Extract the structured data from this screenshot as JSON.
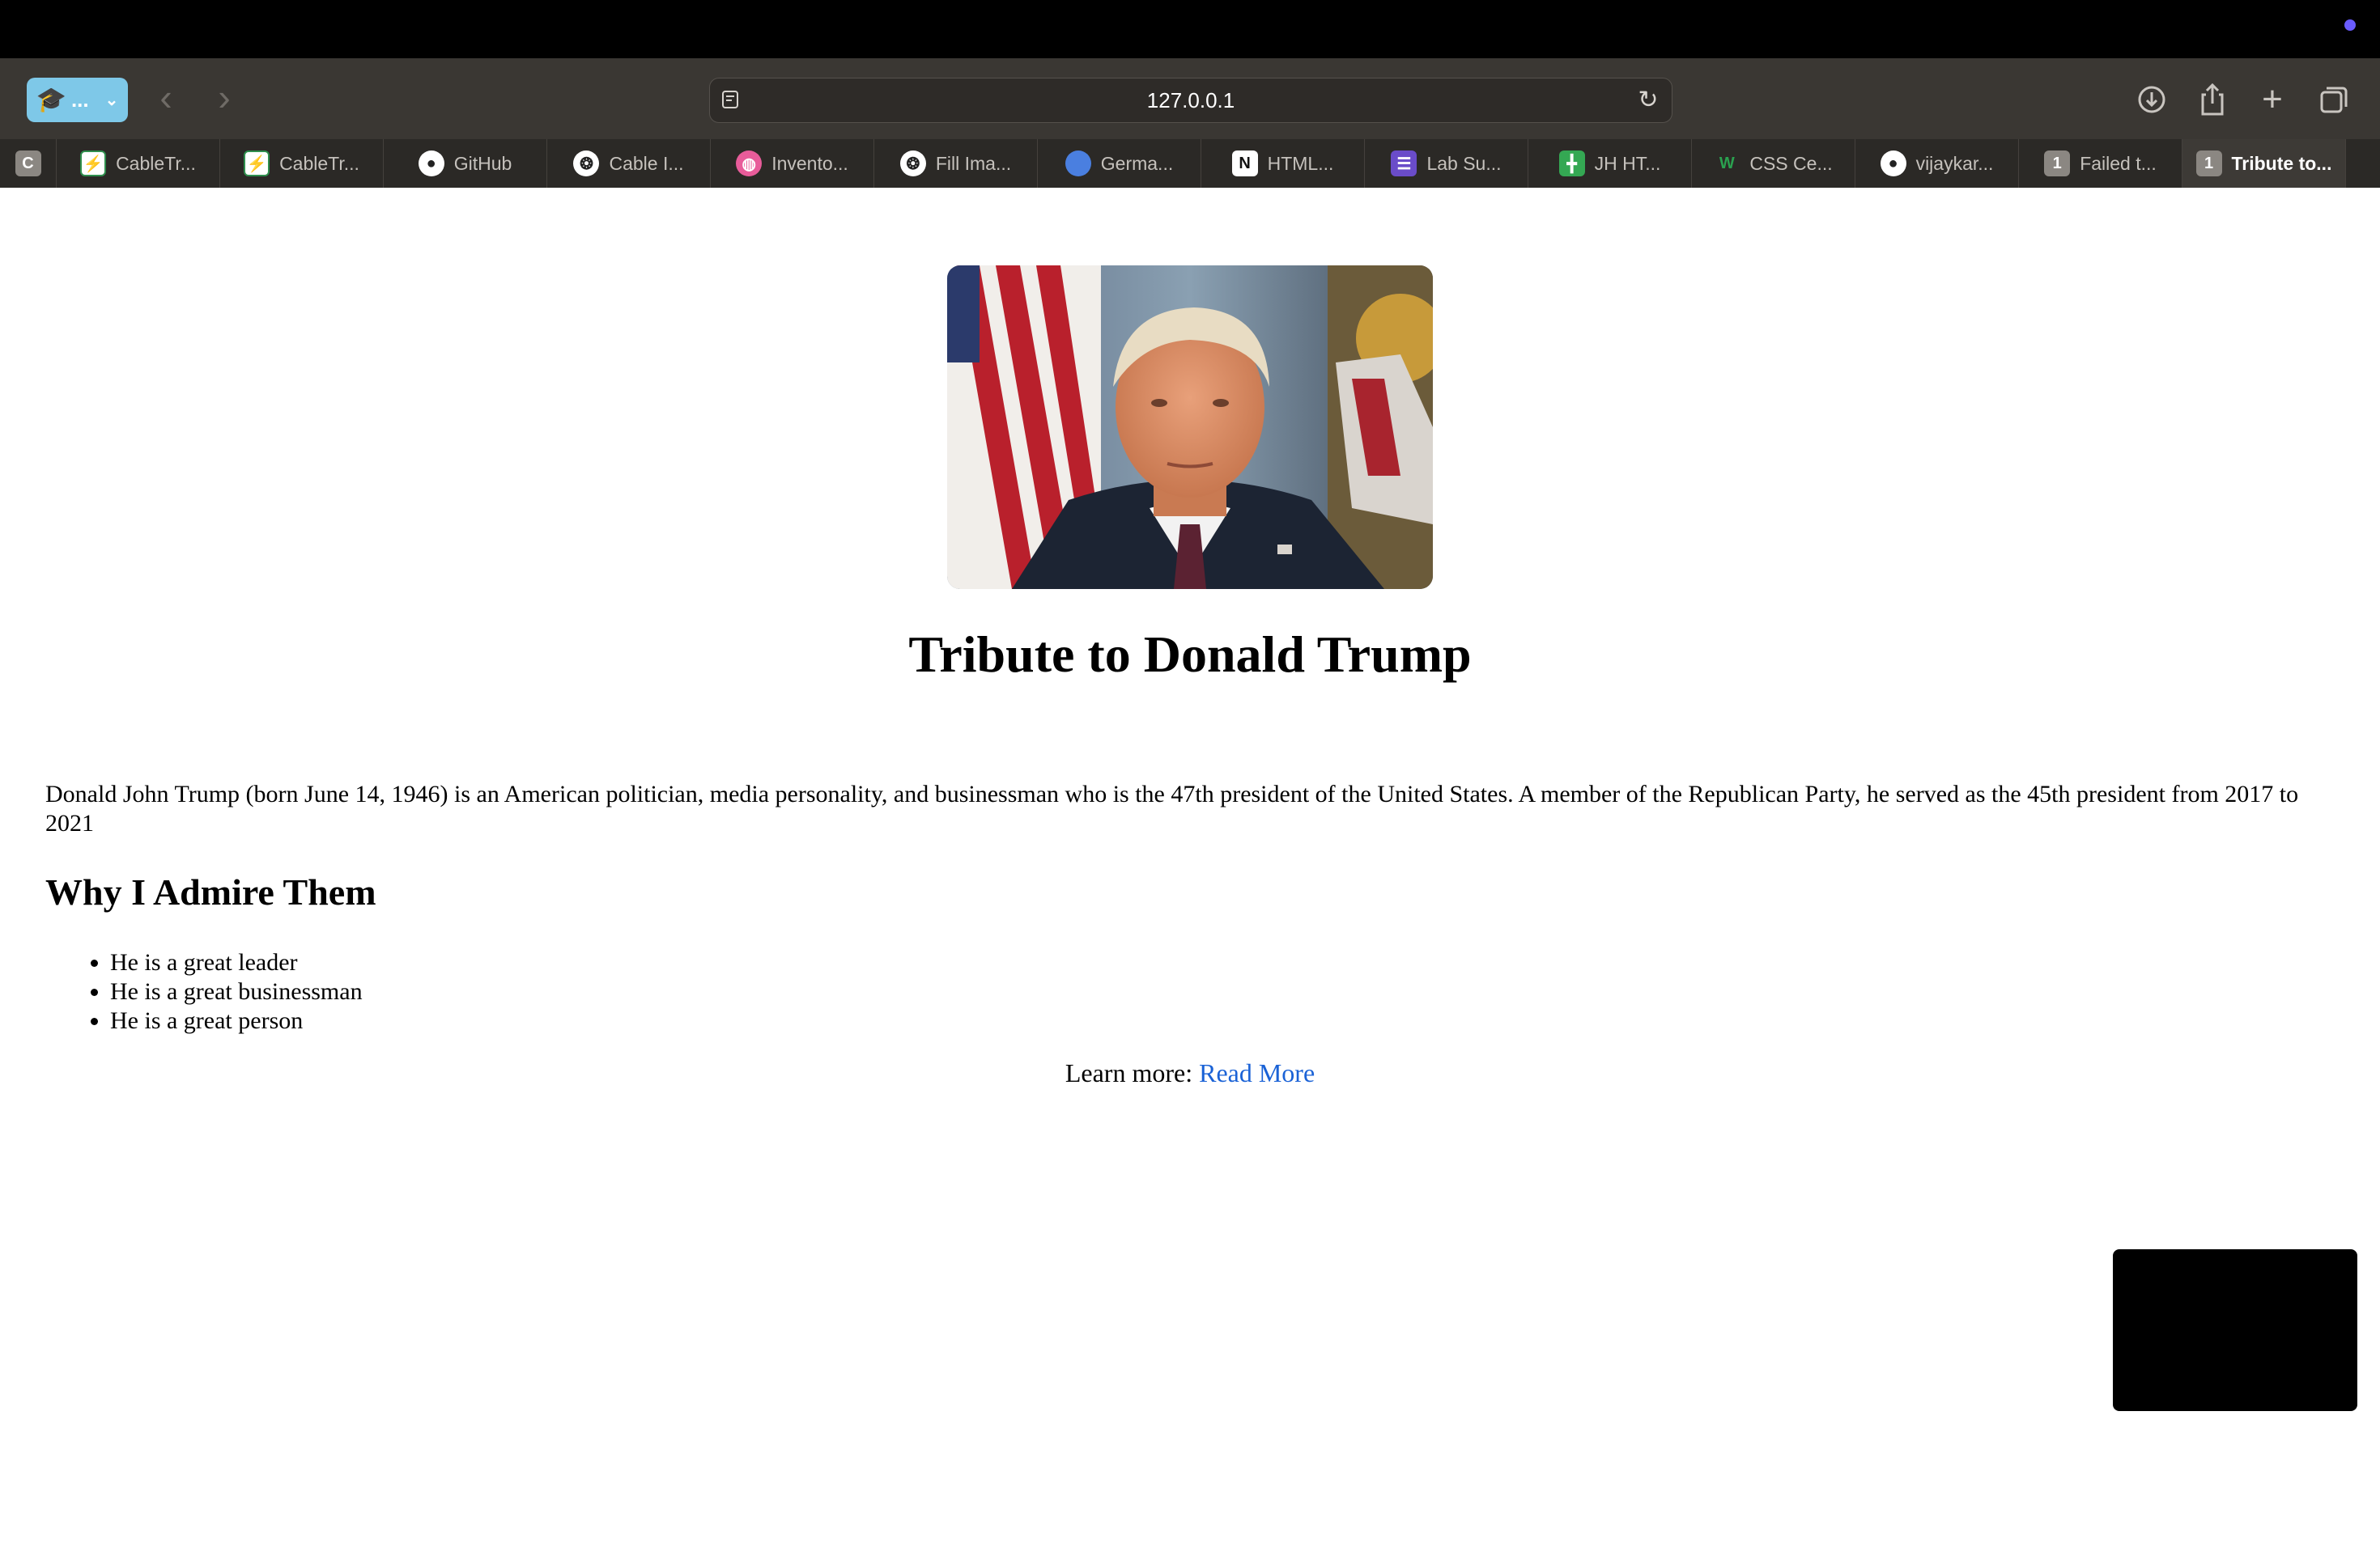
{
  "browser": {
    "profile_label": "...",
    "url": "127.0.0.1",
    "accent_color": "#7ec8e8",
    "indicator_color": "#6a5cff"
  },
  "tabs": [
    {
      "title": "",
      "icon": "c-letter-icon",
      "pinned": true
    },
    {
      "title": "CableTr...",
      "icon": "cabletrack-icon"
    },
    {
      "title": "CableTr...",
      "icon": "cabletrack-icon"
    },
    {
      "title": "GitHub",
      "icon": "github-icon"
    },
    {
      "title": "Cable I...",
      "icon": "openai-icon"
    },
    {
      "title": "Invento...",
      "icon": "dribbble-icon"
    },
    {
      "title": "Fill Ima...",
      "icon": "openai-icon"
    },
    {
      "title": "Germa...",
      "icon": "google-cloud-icon"
    },
    {
      "title": "HTML...",
      "icon": "notion-icon"
    },
    {
      "title": "Lab Su...",
      "icon": "list-icon"
    },
    {
      "title": "JH HT...",
      "icon": "sheets-icon"
    },
    {
      "title": "CSS Ce...",
      "icon": "w3-icon"
    },
    {
      "title": "vijaykar...",
      "icon": "github-icon"
    },
    {
      "title": "Failed t...",
      "icon": "count-badge-icon",
      "badge": "1"
    },
    {
      "title": "Tribute to...",
      "icon": "count-badge-icon",
      "badge": "1",
      "active": true
    }
  ],
  "page": {
    "title": "Tribute to Donald Trump",
    "bio": "Donald John Trump (born June 14, 1946) is an American politician, media personality, and businessman who is the 47th president of the United States. A member of the Republican Party, he served as the 45th president from 2017 to 2021",
    "subheading": "Why I Admire Them",
    "reasons": [
      "He is a great leader",
      "He is a great businessman",
      "He is a great person"
    ],
    "learn_more_prefix": "Learn more: ",
    "learn_more_link": "Read More",
    "link_color": "#1a62d6"
  }
}
